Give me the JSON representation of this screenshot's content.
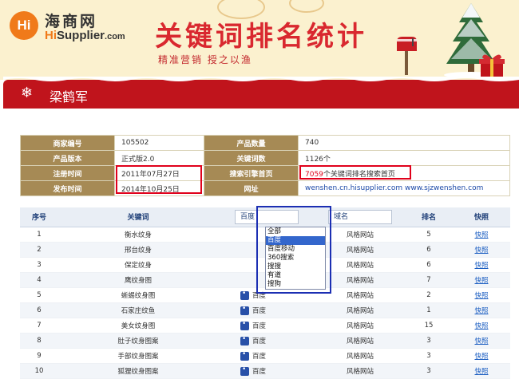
{
  "brand": {
    "logo_mark": "Hi",
    "logo_cn": "海商网",
    "logo_en_hi": "Hi",
    "logo_en_rest": "Supplier",
    "logo_en_com": ".com",
    "title": "关键词排名统计",
    "subtitle": "精准营销  授之以渔"
  },
  "user": {
    "name": "梁鹤军"
  },
  "info": {
    "rows": [
      {
        "label1": "商家编号",
        "value1": "105502",
        "label2": "产品数量",
        "value2": "740"
      },
      {
        "label1": "产品版本",
        "value1": "正式版2.0",
        "label2": "关键词数",
        "value2": "1126个"
      },
      {
        "label1": "注册时间",
        "value1": "2011年07月27日",
        "label2": "搜索引擎首页",
        "value2_num": "7059",
        "value2_rest": "个关键词排名搜索首页"
      },
      {
        "label1": "发布时间",
        "value1": "2014年10月25日",
        "label2": "网址",
        "value2": "wenshen.cn.hisupplier.com www.sjzwenshen.com"
      }
    ]
  },
  "keywords": {
    "headers": {
      "index": "序号",
      "keyword": "关键词",
      "engine": "百度",
      "domain": "域名",
      "rank": "排名",
      "snapshot": "快照"
    },
    "engine_options": [
      "全部",
      "百度",
      "百度移动",
      "360搜索",
      "搜搜",
      "有道",
      "搜狗"
    ],
    "selected_engine": "百度",
    "rows": [
      {
        "index": "1",
        "keyword": "衡水纹身",
        "engine": "",
        "domain": "风格网站",
        "rank": "5",
        "snapshot": "快照"
      },
      {
        "index": "2",
        "keyword": "邢台纹身",
        "engine": "",
        "domain": "风格网站",
        "rank": "6",
        "snapshot": "快照"
      },
      {
        "index": "3",
        "keyword": "保定纹身",
        "engine": "",
        "domain": "风格网站",
        "rank": "6",
        "snapshot": "快照"
      },
      {
        "index": "4",
        "keyword": "鹰纹身图",
        "engine": "",
        "domain": "风格网站",
        "rank": "7",
        "snapshot": "快照"
      },
      {
        "index": "5",
        "keyword": "蜥蜴纹身图",
        "engine": "百度",
        "domain": "风格网站",
        "rank": "2",
        "snapshot": "快照"
      },
      {
        "index": "6",
        "keyword": "石家庄纹鱼",
        "engine": "百度",
        "domain": "风格网站",
        "rank": "1",
        "snapshot": "快照"
      },
      {
        "index": "7",
        "keyword": "美女纹身图",
        "engine": "百度",
        "domain": "风格网站",
        "rank": "15",
        "snapshot": "快照"
      },
      {
        "index": "8",
        "keyword": "肚子纹身图案",
        "engine": "百度",
        "domain": "风格网站",
        "rank": "3",
        "snapshot": "快照"
      },
      {
        "index": "9",
        "keyword": "手部纹身图案",
        "engine": "百度",
        "domain": "风格网站",
        "rank": "3",
        "snapshot": "快照"
      },
      {
        "index": "10",
        "keyword": "狐狸纹身图案",
        "engine": "百度",
        "domain": "风格网站",
        "rank": "3",
        "snapshot": "快照"
      }
    ]
  },
  "colors": {
    "accent_red": "#c0141c",
    "label_brown": "#a68a55",
    "link_blue": "#1d5fc2",
    "highlight_red": "#e0001b",
    "select_blue": "#1c2fb3"
  }
}
